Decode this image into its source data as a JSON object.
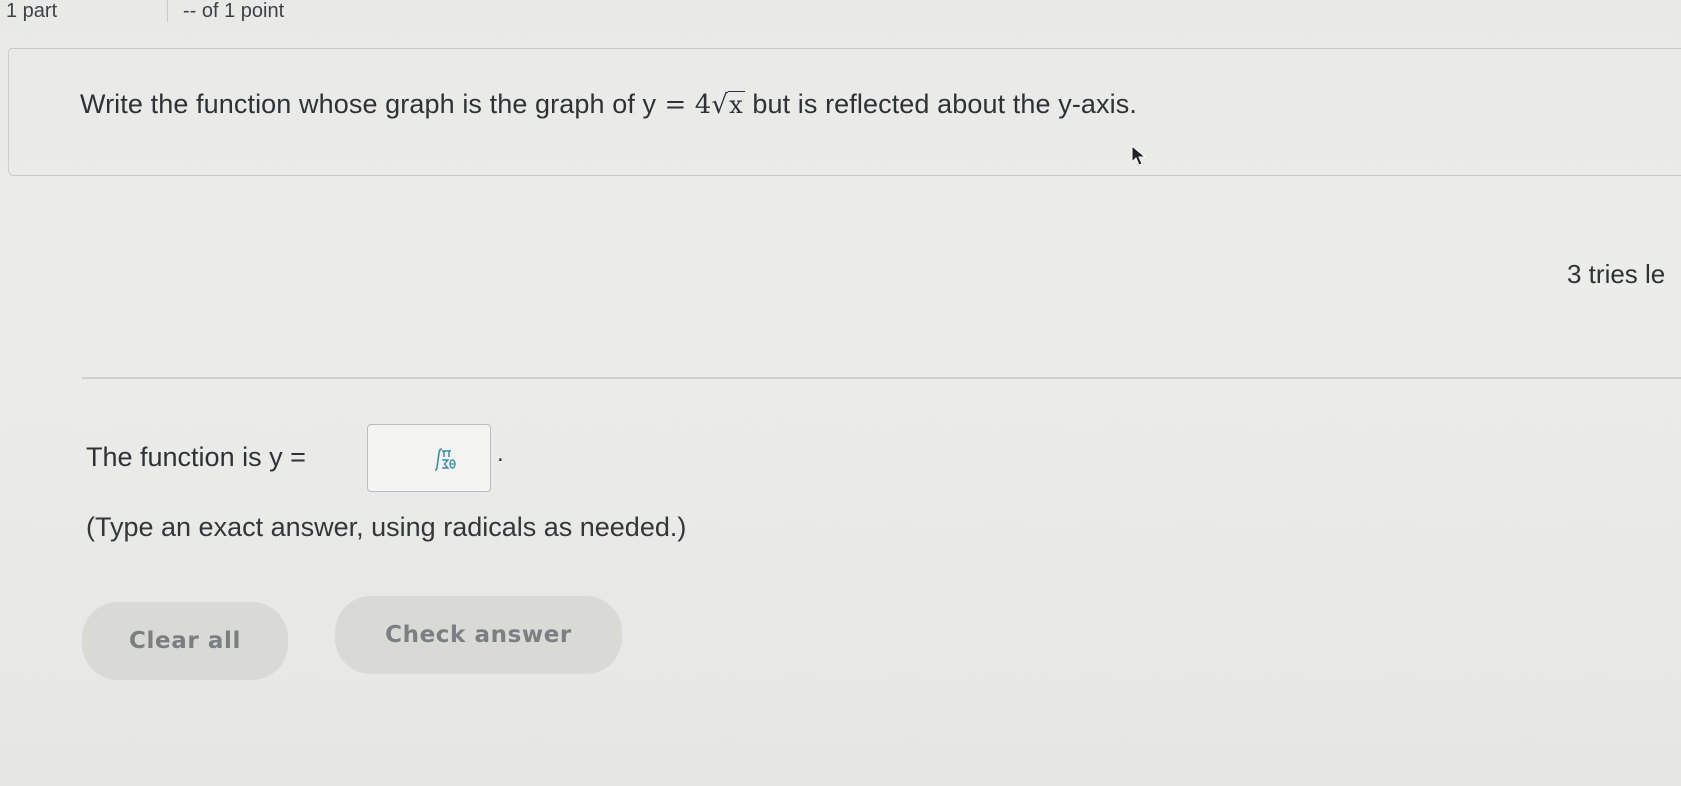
{
  "header": {
    "part_count": "1 part",
    "points": "-- of 1 point"
  },
  "question": {
    "prefix": "Write the function whose graph is the graph of ",
    "equation_lhs": "y",
    "equation_eq": " = ",
    "coefficient": "4",
    "radicand": "x",
    "suffix": " but is reflected about the y-axis."
  },
  "status": {
    "tries_left": "3 tries le"
  },
  "answer": {
    "prompt": "The function is y = ",
    "input_value": "",
    "trailing": ".",
    "hint": "(Type an exact answer, using radicals as needed.)"
  },
  "buttons": {
    "clear_all": "Clear all",
    "check_answer": "Check answer"
  },
  "colors": {
    "background": "#e9e9e7",
    "text": "#2e3136",
    "button_bg": "#d9d9d6",
    "button_text": "#7b7f84",
    "math_icon": "#3a8fa8"
  },
  "icons": {
    "math_palette": "math-palette-icon",
    "cursor": "mouse-cursor-icon"
  }
}
